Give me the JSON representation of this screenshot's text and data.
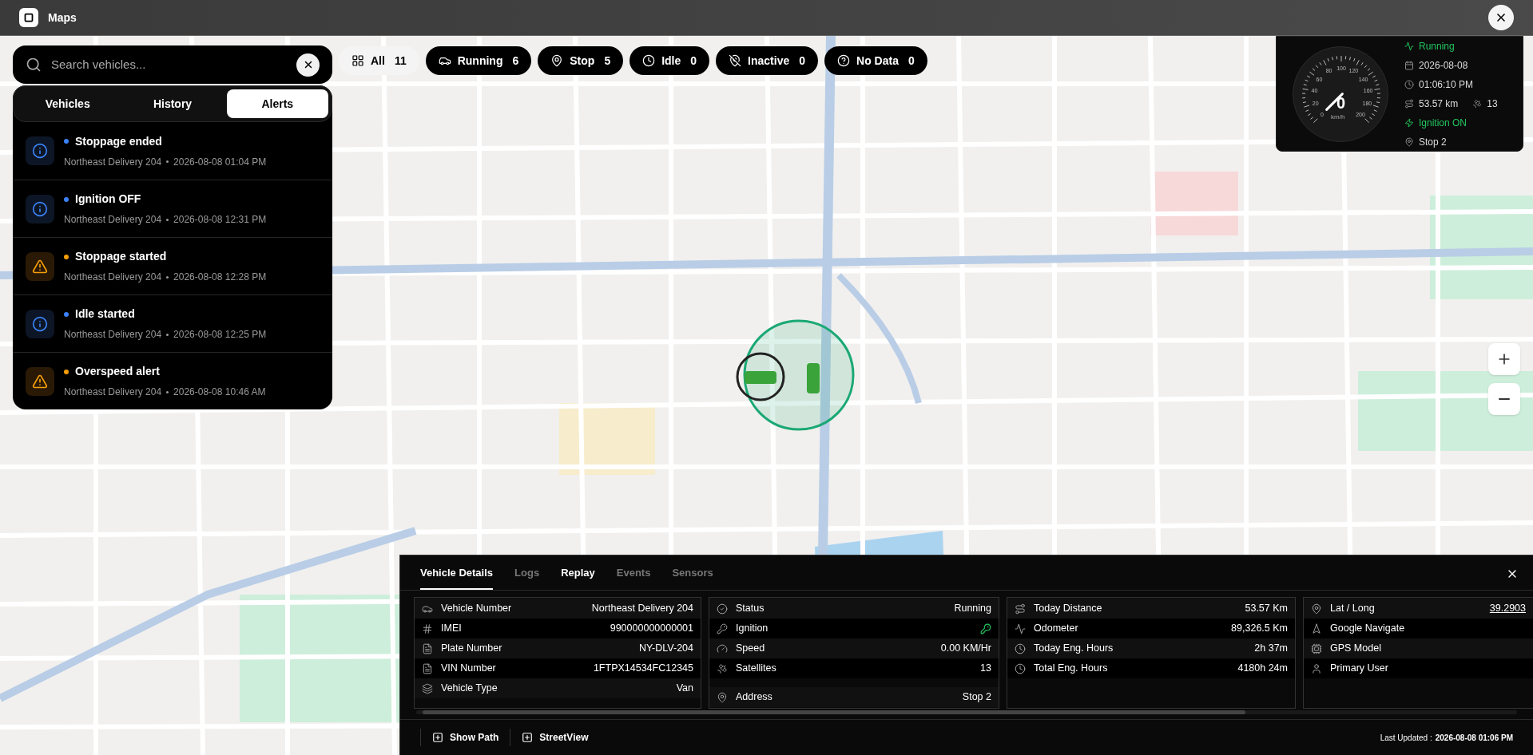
{
  "window": {
    "title": "Maps"
  },
  "search": {
    "placeholder": "Search vehicles..."
  },
  "panel_tabs": [
    {
      "label": "Vehicles",
      "selected": false
    },
    {
      "label": "History",
      "selected": false
    },
    {
      "label": "Alerts",
      "selected": true
    }
  ],
  "alerts": [
    {
      "kind": "info",
      "title": "Stoppage ended",
      "vehicle": "Northeast Delivery 204",
      "time": "2026-08-08 01:04 PM"
    },
    {
      "kind": "info",
      "title": "Ignition OFF",
      "vehicle": "Northeast Delivery 204",
      "time": "2026-08-08 12:31 PM"
    },
    {
      "kind": "warning",
      "title": "Stoppage started",
      "vehicle": "Northeast Delivery 204",
      "time": "2026-08-08 12:28 PM"
    },
    {
      "kind": "info",
      "title": "Idle started",
      "vehicle": "Northeast Delivery 204",
      "time": "2026-08-08 12:25 PM"
    },
    {
      "kind": "warning",
      "title": "Overspeed alert",
      "vehicle": "Northeast Delivery 204",
      "time": "2026-08-08 10:46 AM"
    }
  ],
  "status_filters": [
    {
      "kind": "all",
      "label": "All",
      "count": "11",
      "selected": true
    },
    {
      "kind": "running",
      "label": "Running",
      "count": "6",
      "selected": false
    },
    {
      "kind": "stop",
      "label": "Stop",
      "count": "5",
      "selected": false
    },
    {
      "kind": "idle",
      "label": "Idle",
      "count": "0",
      "selected": false
    },
    {
      "kind": "inactive",
      "label": "Inactive",
      "count": "0",
      "selected": false
    },
    {
      "kind": "nodata",
      "label": "No Data",
      "count": "0",
      "selected": false
    }
  ],
  "gauge": {
    "reading": "0",
    "unit": "km/h",
    "tick_labels": [
      "0",
      "20",
      "40",
      "60",
      "80",
      "100",
      "120",
      "140",
      "160",
      "180",
      "200"
    ],
    "status": "Running",
    "date": "2026-08-08",
    "time": "01:06:10 PM",
    "distance": "53.57 km",
    "satellites": "13",
    "ignition": "Ignition ON",
    "location": "Stop 2"
  },
  "details": {
    "tabs": [
      {
        "label": "Vehicle Details",
        "selected": true,
        "disabled": false
      },
      {
        "label": "Logs",
        "selected": false,
        "disabled": true
      },
      {
        "label": "Replay",
        "selected": false,
        "disabled": false
      },
      {
        "label": "Events",
        "selected": false,
        "disabled": true
      },
      {
        "label": "Sensors",
        "selected": false,
        "disabled": true
      }
    ],
    "cards": [
      {
        "rows": [
          {
            "kind": "text",
            "label": "Vehicle Number",
            "value": "Northeast Delivery 204"
          },
          {
            "kind": "text",
            "label": "IMEI",
            "value": "990000000000001"
          },
          {
            "kind": "text",
            "label": "Plate Number",
            "value": "NY-DLV-204"
          },
          {
            "kind": "text",
            "label": "VIN Number",
            "value": "1FTPX14534FC12345"
          },
          {
            "kind": "text",
            "label": "Vehicle Type",
            "value": "Van"
          }
        ]
      },
      {
        "rows": [
          {
            "kind": "text",
            "label": "Status",
            "value": "Running"
          },
          {
            "kind": "ignition",
            "label": "Ignition",
            "on": true
          },
          {
            "kind": "text",
            "label": "Speed",
            "value": "0.00 KM/Hr"
          },
          {
            "kind": "text",
            "label": "Satellites",
            "value": "13"
          },
          {
            "kind": "text",
            "label": "Address",
            "value": "Stop 2"
          }
        ]
      },
      {
        "rows": [
          {
            "kind": "text",
            "label": "Today Distance",
            "value": "53.57 Km"
          },
          {
            "kind": "text",
            "label": "Odometer",
            "value": "89,326.5 Km"
          },
          {
            "kind": "text",
            "label": "Today Eng. Hours",
            "value": "2h 37m"
          },
          {
            "kind": "text",
            "label": "Total Eng. Hours",
            "value": "4180h 24m"
          }
        ]
      },
      {
        "rows": [
          {
            "kind": "link",
            "label": "Lat / Long",
            "value": "39.2903"
          },
          {
            "kind": "text",
            "label": "Google Navigate"
          },
          {
            "kind": "text",
            "label": "GPS Model"
          },
          {
            "kind": "text",
            "label": "Primary User"
          }
        ]
      }
    ],
    "actions": [
      "Show Path",
      "StreetView"
    ],
    "last_updated_label": "Last Updated :",
    "last_updated": "2026-08-08 01:06 PM"
  }
}
